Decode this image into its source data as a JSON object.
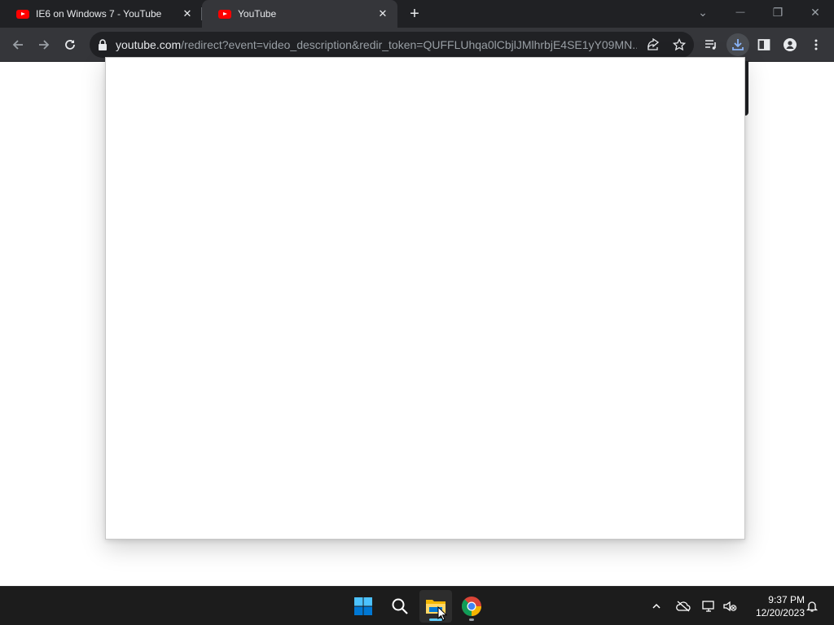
{
  "tabs": [
    {
      "title": "IE6 on Windows 7 - YouTube",
      "favicon": "youtube-icon",
      "close_label": "✕"
    },
    {
      "title": "YouTube",
      "favicon": "youtube-icon",
      "close_label": "✕"
    }
  ],
  "new_tab_label": "+",
  "window_controls": {
    "tab_search": "⌄",
    "minimize": "—",
    "restore": "❐",
    "close": "✕"
  },
  "address_bar": {
    "host": "youtube.com",
    "path": "/redirect?event=video_description&redir_token=QUFFLUhqa0lCbjlJMlhrbjE4SE1yY09MN..."
  },
  "taskbar": {
    "time": "9:37 PM",
    "date": "12/20/2023",
    "apps": [
      "start-icon",
      "search-icon",
      "file-explorer-icon",
      "chrome-icon"
    ]
  },
  "colors": {
    "tab_strip": "#202124",
    "toolbar": "#35363a",
    "omnibox": "#202124",
    "taskbar": "#1c1c1c",
    "youtube_red": "#ff0000",
    "windows_blue": "#0078d4"
  }
}
